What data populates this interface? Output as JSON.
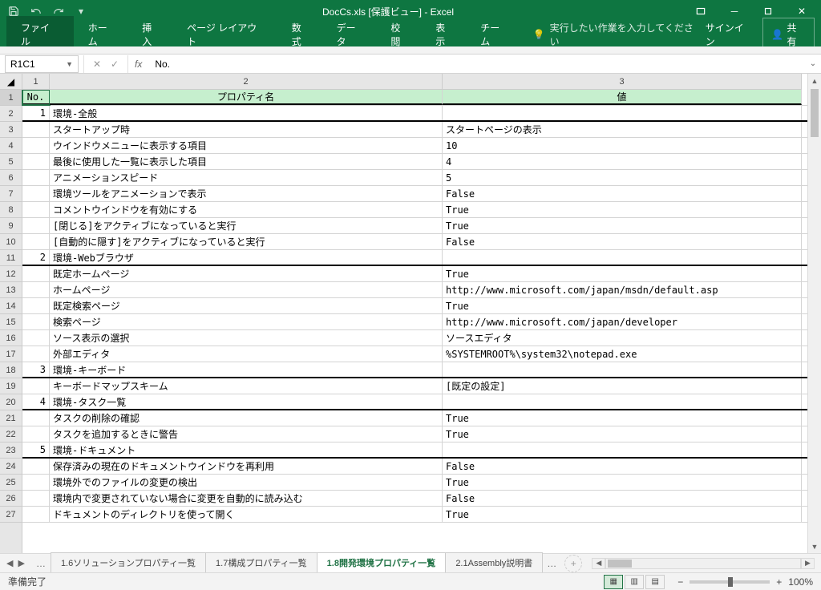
{
  "title": "DocCs.xls [保護ビュー] - Excel",
  "qat": {
    "save": "保存",
    "undo": "元に戻す",
    "redo": "やり直し"
  },
  "tabs": [
    "ファイル",
    "ホーム",
    "挿入",
    "ページ レイアウト",
    "数式",
    "データ",
    "校閲",
    "表示",
    "チーム"
  ],
  "tell_me": "実行したい作業を入力してください",
  "signin": "サインイン",
  "share": "共有",
  "name_box": "R1C1",
  "formula": "No.",
  "col_headers": [
    "1",
    "2",
    "3"
  ],
  "row_headers": [
    "1",
    "2",
    "3",
    "4",
    "5",
    "6",
    "7",
    "8",
    "9",
    "10",
    "11",
    "12",
    "13",
    "14",
    "15",
    "16",
    "17",
    "18",
    "19",
    "20",
    "21",
    "22",
    "23",
    "24",
    "25",
    "26",
    "27"
  ],
  "header_row": {
    "no": "No.",
    "prop": "プロパティ名",
    "val": "値"
  },
  "rows": [
    {
      "no": "1",
      "prop": "環境-全般",
      "val": "",
      "section": true
    },
    {
      "no": "",
      "prop": "スタートアップ時",
      "val": "スタートページの表示"
    },
    {
      "no": "",
      "prop": "ウインドウメニューに表示する項目",
      "val": "10"
    },
    {
      "no": "",
      "prop": "最後に使用した一覧に表示した項目",
      "val": "4"
    },
    {
      "no": "",
      "prop": "アニメーションスピード",
      "val": "5"
    },
    {
      "no": "",
      "prop": "環境ツールをアニメーションで表示",
      "val": "False"
    },
    {
      "no": "",
      "prop": "コメントウインドウを有効にする",
      "val": "True"
    },
    {
      "no": "",
      "prop": "[閉じる]をアクティブになっていると実行",
      "val": "True"
    },
    {
      "no": "",
      "prop": "[自動的に隠す]をアクティブになっていると実行",
      "val": "False"
    },
    {
      "no": "2",
      "prop": "環境-Webブラウザ",
      "val": "",
      "section": true
    },
    {
      "no": "",
      "prop": "既定ホームページ",
      "val": "True"
    },
    {
      "no": "",
      "prop": "ホームページ",
      "val": "http://www.microsoft.com/japan/msdn/default.asp"
    },
    {
      "no": "",
      "prop": "既定検索ページ",
      "val": "True"
    },
    {
      "no": "",
      "prop": "検索ページ",
      "val": "http://www.microsoft.com/japan/developer"
    },
    {
      "no": "",
      "prop": "ソース表示の選択",
      "val": "ソースエディタ"
    },
    {
      "no": "",
      "prop": "外部エディタ",
      "val": "%SYSTEMROOT%\\system32\\notepad.exe"
    },
    {
      "no": "3",
      "prop": "環境-キーボード",
      "val": "",
      "section": true
    },
    {
      "no": "",
      "prop": "キーボードマップスキーム",
      "val": "[既定の設定]"
    },
    {
      "no": "4",
      "prop": "環境-タスク一覧",
      "val": "",
      "section": true
    },
    {
      "no": "",
      "prop": "タスクの削除の確認",
      "val": "True"
    },
    {
      "no": "",
      "prop": "タスクを追加するときに警告",
      "val": "True"
    },
    {
      "no": "5",
      "prop": "環境-ドキュメント",
      "val": "",
      "section": true
    },
    {
      "no": "",
      "prop": "保存済みの現在のドキュメントウインドウを再利用",
      "val": "False"
    },
    {
      "no": "",
      "prop": "環境外でのファイルの変更の検出",
      "val": "True"
    },
    {
      "no": "",
      "prop": "環境内で変更されていない場合に変更を自動的に読み込む",
      "val": "False"
    },
    {
      "no": "",
      "prop": "ドキュメントのディレクトリを使って開く",
      "val": "True"
    }
  ],
  "sheets": [
    "1.6ソリューションプロパティ一覧",
    "1.7構成プロパティ一覧",
    "1.8開発環境プロパティ一覧",
    "2.1Assembly説明書"
  ],
  "active_sheet": 2,
  "status": "準備完了",
  "zoom": "100%"
}
